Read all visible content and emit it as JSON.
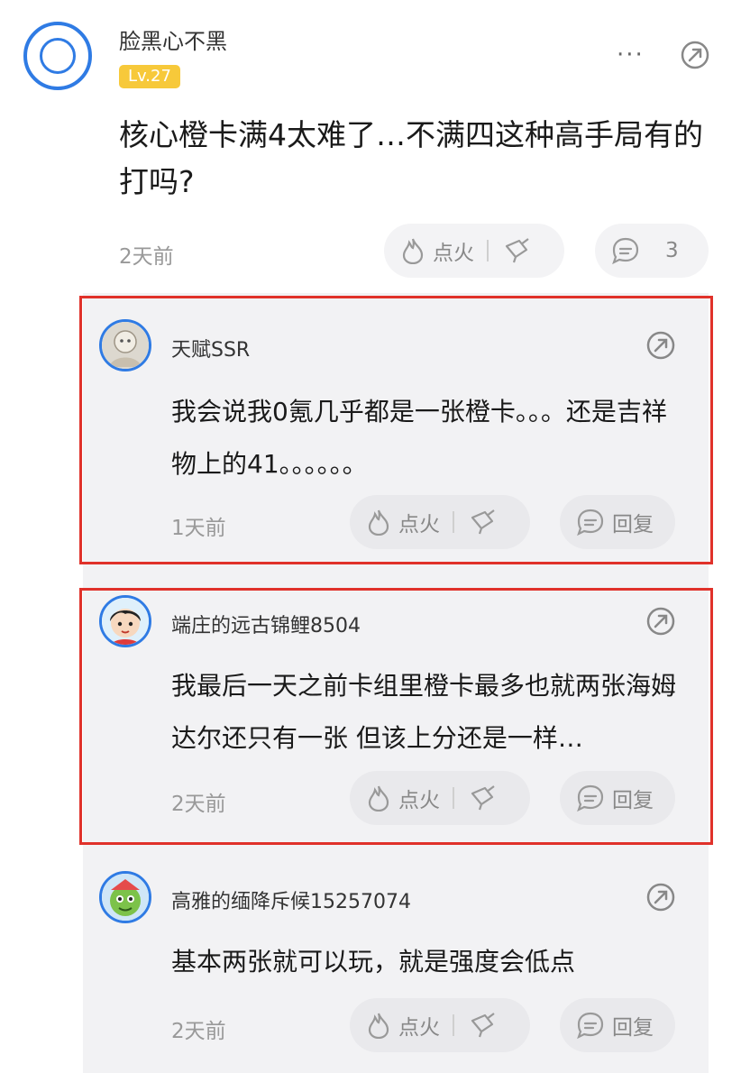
{
  "post": {
    "username": "脸黑心不黑",
    "level": "Lv.27",
    "more": "···",
    "text": "核心橙卡满4太难了…不满四这种高手局有的打吗?",
    "time": "2天前",
    "ignite_label": "点火",
    "reply_count": "3"
  },
  "replies": [
    {
      "username": "天赋SSR",
      "text": "我会说我0氪几乎都是一张橙卡。。。还是吉祥物上的41。。。。。。",
      "time": "1天前",
      "ignite_label": "点火",
      "reply_label": "回复"
    },
    {
      "username": "端庄的远古锦鲤8504",
      "text": "我最后一天之前卡组里橙卡最多也就两张海姆达尔还只有一张 但该上分还是一样…",
      "time": "2天前",
      "ignite_label": "点火",
      "reply_label": "回复"
    },
    {
      "username": "高雅的缅降斥候15257074",
      "text": "基本两张就可以玩，就是强度会低点",
      "time": "2天前",
      "ignite_label": "点火",
      "reply_label": "回复"
    }
  ],
  "colors": {
    "accent": "#2f7be4",
    "level_badge": "#f7c93a",
    "highlight_box": "#e0312a",
    "muted_text": "#999999"
  }
}
